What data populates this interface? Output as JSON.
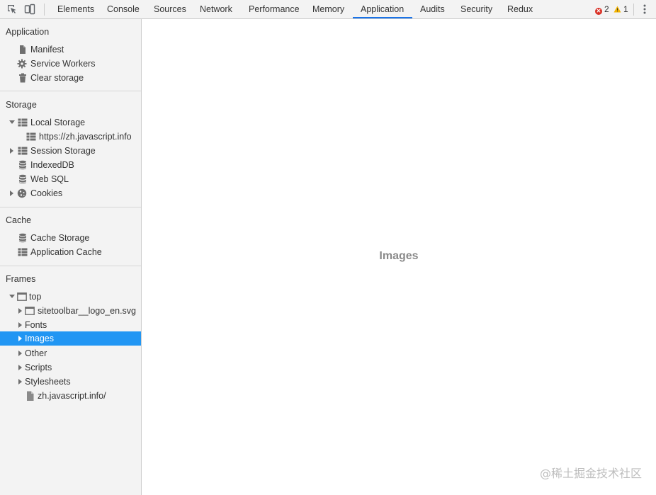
{
  "toolbar": {
    "tabs": [
      {
        "label": "Elements"
      },
      {
        "label": "Console"
      },
      {
        "label": "Sources"
      },
      {
        "label": "Network"
      },
      {
        "label": "Performance"
      },
      {
        "label": "Memory"
      },
      {
        "label": "Application"
      },
      {
        "label": "Audits"
      },
      {
        "label": "Security"
      },
      {
        "label": "Redux"
      }
    ],
    "active_tab": "Application",
    "error_count": "2",
    "warning_count": "1",
    "accent_color": "#1a73e8"
  },
  "sidebar": {
    "sections": {
      "application": {
        "title": "Application",
        "items": [
          {
            "label": "Manifest",
            "icon": "file-icon"
          },
          {
            "label": "Service Workers",
            "icon": "gear-icon"
          },
          {
            "label": "Clear storage",
            "icon": "trash-icon"
          }
        ]
      },
      "storage": {
        "title": "Storage",
        "items": [
          {
            "label": "Local Storage",
            "icon": "table-icon"
          },
          {
            "label": "https://zh.javascript.info",
            "icon": "table-icon"
          },
          {
            "label": "Session Storage",
            "icon": "table-icon"
          },
          {
            "label": "IndexedDB",
            "icon": "database-icon"
          },
          {
            "label": "Web SQL",
            "icon": "database-icon"
          },
          {
            "label": "Cookies",
            "icon": "cookie-icon"
          }
        ]
      },
      "cache": {
        "title": "Cache",
        "items": [
          {
            "label": "Cache Storage",
            "icon": "database-icon"
          },
          {
            "label": "Application Cache",
            "icon": "table-icon"
          }
        ]
      },
      "frames": {
        "title": "Frames",
        "items": [
          {
            "label": "top",
            "icon": "frame-icon"
          },
          {
            "label": "sitetoolbar__logo_en.svg",
            "icon": "frame-icon"
          },
          {
            "label": "Fonts"
          },
          {
            "label": "Images"
          },
          {
            "label": "Other"
          },
          {
            "label": "Scripts"
          },
          {
            "label": "Stylesheets"
          },
          {
            "label": "zh.javascript.info/",
            "icon": "file-icon"
          }
        ]
      }
    },
    "selected_color": "#2196f3"
  },
  "main": {
    "title": "Images"
  },
  "watermark": "@稀土掘金技术社区"
}
